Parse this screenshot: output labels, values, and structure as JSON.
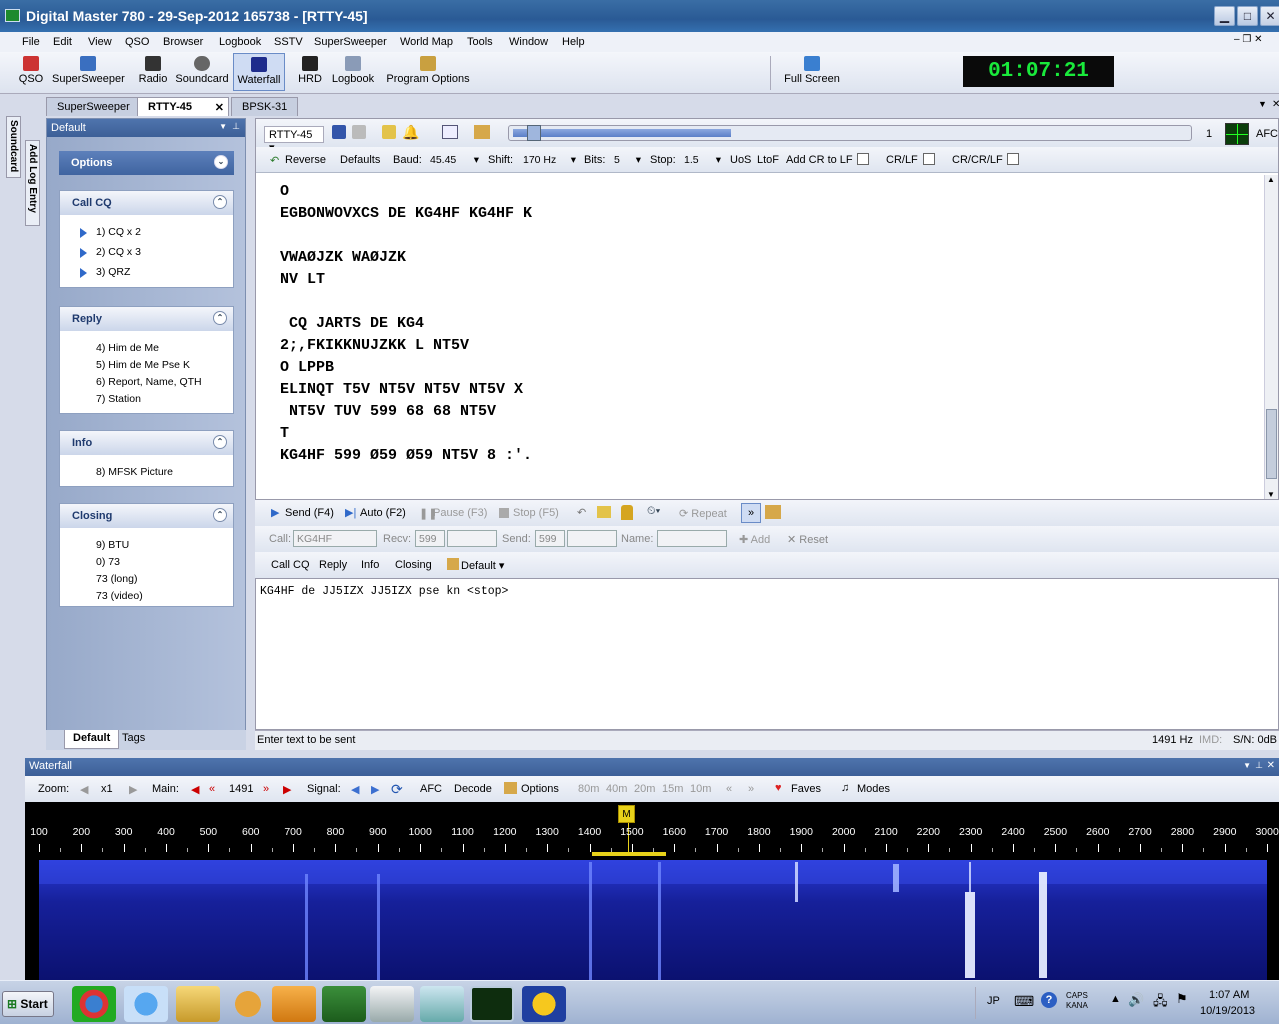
{
  "window": {
    "title": "Digital Master 780 - 29-Sep-2012 165738 - [RTTY-45]"
  },
  "menu": [
    "File",
    "Edit",
    "View",
    "QSO",
    "Browser",
    "Logbook",
    "SSTV",
    "SuperSweeper",
    "World Map",
    "Tools",
    "Window",
    "Help"
  ],
  "toolbar": {
    "items": [
      "QSO",
      "SuperSweeper",
      "Radio",
      "Soundcard",
      "Waterfall",
      "HRD",
      "Logbook",
      "Program Options"
    ],
    "fullscreen": "Full Screen",
    "clock": "01:07:21"
  },
  "doc_tabs": [
    "SuperSweeper",
    "RTTY-45",
    "BPSK-31"
  ],
  "vertical_tabs": [
    "Soundcard",
    "Add Log Entry"
  ],
  "left_panel": {
    "header": "Default",
    "options_label": "Options",
    "groups": [
      {
        "title": "Call CQ",
        "items": [
          "1) CQ x 2",
          "2) CQ x 3",
          "3) QRZ"
        ]
      },
      {
        "title": "Reply",
        "items": [
          "4) Him de Me",
          "5) Him de Me Pse K",
          "6) Report, Name, QTH",
          "7) Station"
        ]
      },
      {
        "title": "Info",
        "items": [
          "8) MFSK Picture"
        ]
      },
      {
        "title": "Closing",
        "items": [
          "9) BTU",
          "0) 73",
          "73 (long)",
          "73 (video)"
        ]
      }
    ],
    "bottom_tabs": [
      "Default",
      "Tags"
    ]
  },
  "rx": {
    "mode": "RTTY-45",
    "channel": "1",
    "afc": "AFC",
    "reverse": "Reverse",
    "defaults": "Defaults",
    "baud_label": "Baud:",
    "baud": "45.45",
    "shift_label": "Shift:",
    "shift": "170 Hz",
    "bits_label": "Bits:",
    "bits": "5",
    "stop_label": "Stop:",
    "stop": "1.5",
    "uos": "UoS",
    "ltof": "LtoF",
    "add_cr": "Add CR to LF",
    "crlf": "CR/LF",
    "crcrlf": "CR/CR/LF",
    "lines": [
      "O",
      "EGBONWOVXCS DE KG4HF KG4HF K",
      "",
      "VWAØJZK WAØJZK",
      "NV LT",
      "",
      " CQ JARTS DE KG4",
      "2;,FKIKKNUJZKK L NT5V",
      "O LPPB",
      "ELINQT T5V NT5V NT5V NT5V X",
      " NT5V TUV 599 68 68 NT5V",
      "T",
      "KG4HF 599 Ø59 Ø59 NT5V 8 :'."
    ]
  },
  "tx": {
    "send": "Send (F4)",
    "auto": "Auto (F2)",
    "pause": "Pause (F3)",
    "stop": "Stop (F5)",
    "repeat": "Repeat",
    "call_label": "Call:",
    "call": "KG4HF",
    "recv_label": "Recv:",
    "recv": "599",
    "send_label": "Send:",
    "send_val": "599",
    "name_label": "Name:",
    "add": "Add",
    "reset": "Reset",
    "macro_tabs": [
      "Call CQ",
      "Reply",
      "Info",
      "Closing"
    ],
    "macro_default": "Default",
    "text": "KG4HF de JJ5IZX JJ5IZX pse kn <stop>"
  },
  "status": {
    "hint": "Enter text to be sent",
    "freq": "1491 Hz",
    "imd": "IMD:",
    "sn": "S/N: 0dB"
  },
  "waterfall": {
    "title": "Waterfall",
    "zoom_label": "Zoom:",
    "zoom": "x1",
    "main_label": "Main:",
    "main": "1491",
    "signal_label": "Signal:",
    "afc": "AFC",
    "decode": "Decode",
    "options": "Options",
    "bands": [
      "80m",
      "40m",
      "20m",
      "15m",
      "10m"
    ],
    "faves": "Faves",
    "modes": "Modes",
    "marker": "M",
    "ticks": [
      "100",
      "200",
      "300",
      "400",
      "500",
      "600",
      "700",
      "800",
      "900",
      "1000",
      "1100",
      "1200",
      "1300",
      "1400",
      "1500",
      "1600",
      "1700",
      "1800",
      "1900",
      "2000",
      "2100",
      "2200",
      "2300",
      "2400",
      "2500",
      "2600",
      "2700",
      "2800",
      "2900",
      "3000"
    ]
  },
  "taskbar": {
    "start": "Start",
    "lang": "JP",
    "caps": "CAPS",
    "kana": "KANA",
    "time": "1:07 AM",
    "date": "10/19/2013"
  }
}
